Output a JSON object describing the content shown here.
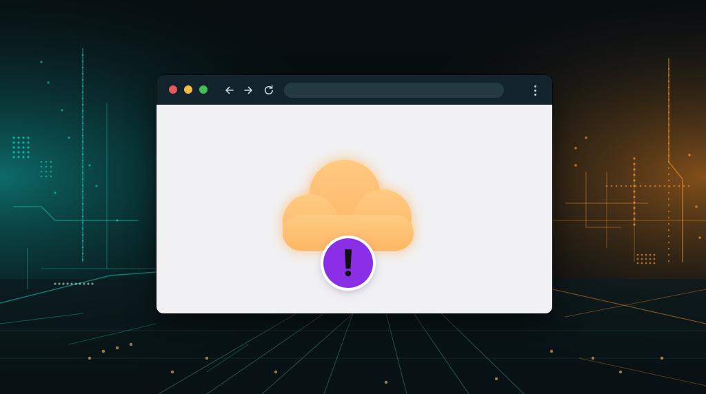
{
  "browser": {
    "window_controls": [
      "close",
      "minimize",
      "maximize"
    ],
    "nav_icons": [
      "back-arrow-icon",
      "forward-arrow-icon",
      "reload-icon"
    ],
    "address_bar": {
      "value": "",
      "placeholder": ""
    },
    "menu_icon": "more-vertical-icon"
  },
  "content": {
    "illustration": "cloud-icon",
    "status_icon": "exclamation-icon"
  },
  "colors": {
    "close": "#e85a5a",
    "minimize": "#f2bd42",
    "maximize": "#46bd55",
    "cloud": "#ffc47a",
    "badge": "#8a2fe6",
    "titlebar": "#12232b",
    "page": "#f1f1f3",
    "accent_left": "#19d6c3",
    "accent_right": "#ff9a2e"
  }
}
